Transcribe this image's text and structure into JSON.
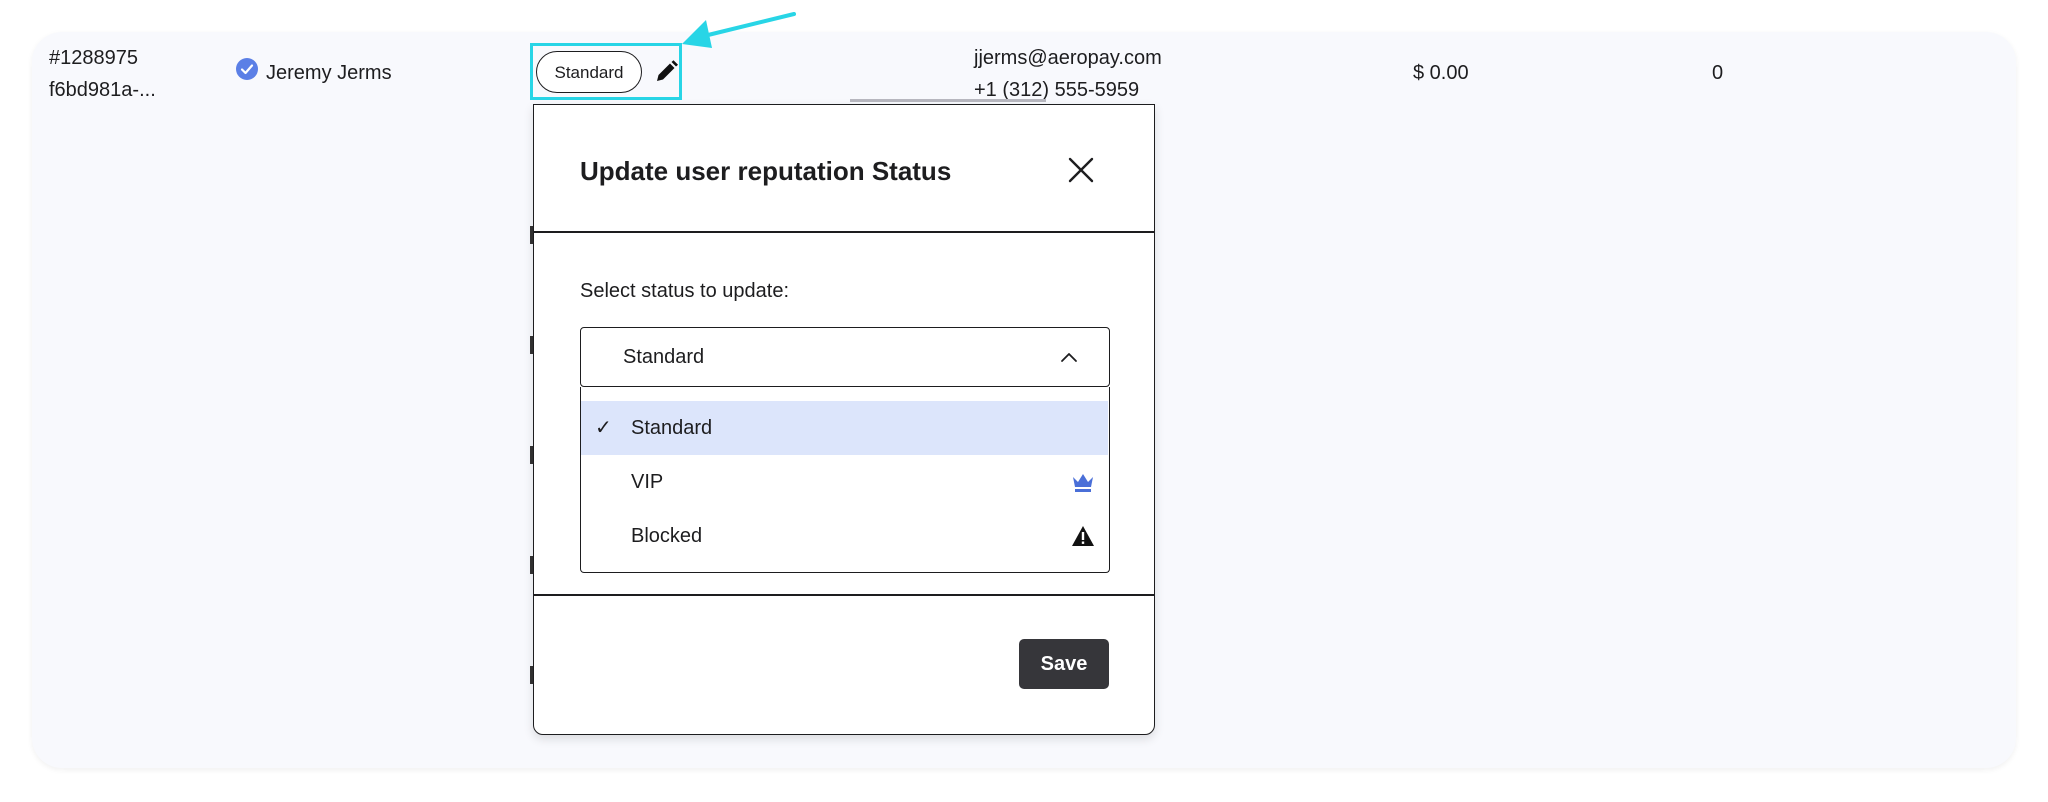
{
  "row": {
    "id": "#1288975",
    "uuid": "f6bd981a-...",
    "name": "Jeremy Jerms",
    "status_badge": "Standard",
    "email": "jjerms@aeropay.com",
    "phone": "+1 (312) 555-5959",
    "balance": "$ 0.00",
    "count": "0"
  },
  "icons": {
    "verified": "verified-check-icon",
    "edit": "pencil-icon",
    "close": "close-icon",
    "chevron": "chevron-up-icon",
    "check": "checkmark-icon",
    "vip": "crown-icon",
    "blocked": "warning-icon"
  },
  "modal": {
    "title": "Update user reputation Status",
    "select_label": "Select status to update:",
    "selected_value": "Standard",
    "options": [
      {
        "label": "Standard",
        "selected": true,
        "check": "✓"
      },
      {
        "label": "VIP",
        "selected": false
      },
      {
        "label": "Blocked",
        "selected": false
      }
    ],
    "save_label": "Save"
  },
  "colors": {
    "highlight": "#28d5e6",
    "verified": "#5b7fe6",
    "crown": "#4a6fd8",
    "selected_option": "#dce5fb",
    "save_button": "#36363a"
  }
}
